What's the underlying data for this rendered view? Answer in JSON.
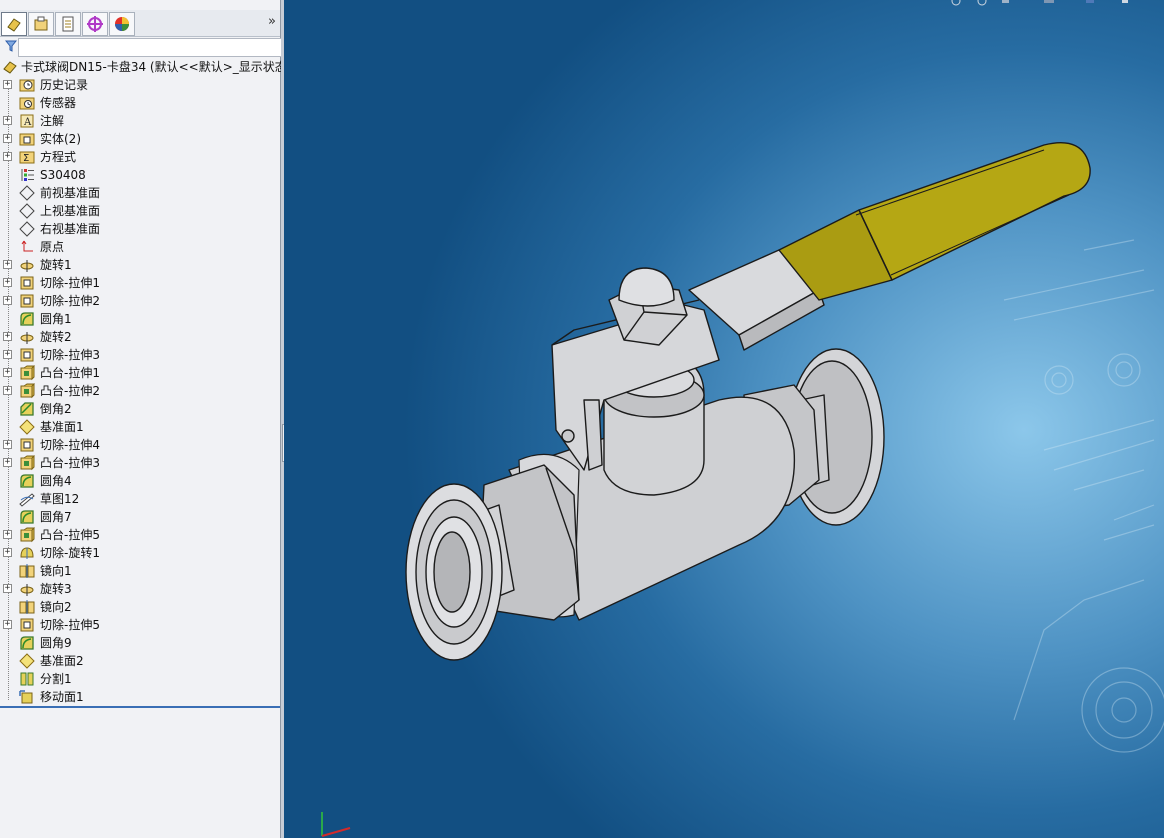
{
  "feature_manager": {
    "root_label": "卡式球阀DN15-卡盘34 (默认<<默认>_显示状态",
    "expand_glyph": "»",
    "filter_placeholder": "",
    "items": [
      {
        "label": "历史记录",
        "icon": "history-folder-icon",
        "expandable": true
      },
      {
        "label": "传感器",
        "icon": "sensor-folder-icon",
        "expandable": false
      },
      {
        "label": "注解",
        "icon": "annotations-icon",
        "expandable": true
      },
      {
        "label": "实体(2)",
        "icon": "solid-bodies-icon",
        "expandable": true
      },
      {
        "label": "方程式",
        "icon": "equations-icon",
        "expandable": true
      },
      {
        "label": "S30408",
        "icon": "material-icon",
        "expandable": false
      },
      {
        "label": "前视基准面",
        "icon": "plane-icon",
        "expandable": false
      },
      {
        "label": "上视基准面",
        "icon": "plane-icon",
        "expandable": false
      },
      {
        "label": "右视基准面",
        "icon": "plane-icon",
        "expandable": false
      },
      {
        "label": "原点",
        "icon": "origin-icon",
        "expandable": false
      },
      {
        "label": "旋转1",
        "icon": "revolve-icon",
        "expandable": true
      },
      {
        "label": "切除-拉伸1",
        "icon": "cut-extrude-icon",
        "expandable": true
      },
      {
        "label": "切除-拉伸2",
        "icon": "cut-extrude-icon",
        "expandable": true
      },
      {
        "label": "圆角1",
        "icon": "fillet-icon",
        "expandable": false
      },
      {
        "label": "旋转2",
        "icon": "revolve-icon",
        "expandable": true
      },
      {
        "label": "切除-拉伸3",
        "icon": "cut-extrude-icon",
        "expandable": true
      },
      {
        "label": "凸台-拉伸1",
        "icon": "boss-extrude-icon",
        "expandable": true
      },
      {
        "label": "凸台-拉伸2",
        "icon": "boss-extrude-icon",
        "expandable": true
      },
      {
        "label": "倒角2",
        "icon": "chamfer-icon",
        "expandable": false
      },
      {
        "label": "基准面1",
        "icon": "ref-plane-icon",
        "expandable": false
      },
      {
        "label": "切除-拉伸4",
        "icon": "cut-extrude-icon",
        "expandable": true
      },
      {
        "label": "凸台-拉伸3",
        "icon": "boss-extrude-icon",
        "expandable": true
      },
      {
        "label": "圆角4",
        "icon": "fillet-icon",
        "expandable": false
      },
      {
        "label": "草图12",
        "icon": "sketch-icon",
        "expandable": false
      },
      {
        "label": "圆角7",
        "icon": "fillet-icon",
        "expandable": false
      },
      {
        "label": "凸台-拉伸5",
        "icon": "boss-extrude-icon",
        "expandable": true
      },
      {
        "label": "切除-旋转1",
        "icon": "cut-revolve-icon",
        "expandable": true
      },
      {
        "label": "镜向1",
        "icon": "mirror-icon",
        "expandable": false
      },
      {
        "label": "旋转3",
        "icon": "revolve-icon",
        "expandable": true
      },
      {
        "label": "镜向2",
        "icon": "mirror-icon",
        "expandable": false
      },
      {
        "label": "切除-拉伸5",
        "icon": "cut-extrude-icon",
        "expandable": true
      },
      {
        "label": "圆角9",
        "icon": "fillet-icon",
        "expandable": false
      },
      {
        "label": "基准面2",
        "icon": "ref-plane-icon",
        "expandable": false
      },
      {
        "label": "分割1",
        "icon": "split-icon",
        "expandable": false
      },
      {
        "label": "移动面1",
        "icon": "move-face-icon",
        "expandable": false
      }
    ]
  },
  "tabs": [
    {
      "name": "feature-manager-tab",
      "icon": "feature-tree-icon"
    },
    {
      "name": "property-manager-tab",
      "icon": "property-icon"
    },
    {
      "name": "configuration-manager-tab",
      "icon": "configuration-icon"
    },
    {
      "name": "dimxpert-tab",
      "icon": "dimxpert-icon"
    },
    {
      "name": "display-manager-tab",
      "icon": "display-manager-icon"
    }
  ],
  "viewport": {
    "model": "ball-valve-3d-model",
    "handle_color": "#a5980f",
    "body_color": "#c9cacd",
    "background_top": "#124f82",
    "background_center": "#8cc7ea"
  }
}
